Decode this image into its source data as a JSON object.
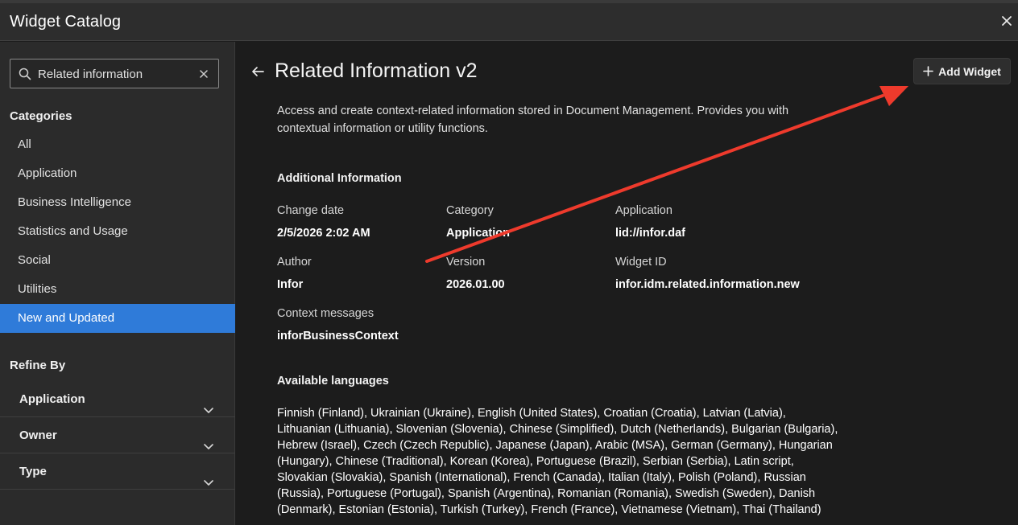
{
  "window": {
    "title": "Widget Catalog"
  },
  "search": {
    "value": "Related information"
  },
  "categories": {
    "heading": "Categories",
    "items": [
      {
        "label": "All"
      },
      {
        "label": "Application"
      },
      {
        "label": "Business Intelligence"
      },
      {
        "label": "Statistics and Usage"
      },
      {
        "label": "Social"
      },
      {
        "label": "Utilities"
      },
      {
        "label": "New and Updated",
        "active": true
      }
    ]
  },
  "refine": {
    "heading": "Refine By",
    "items": [
      {
        "label": "Application"
      },
      {
        "label": "Owner"
      },
      {
        "label": "Type"
      }
    ]
  },
  "detail": {
    "title": "Related Information v2",
    "add_button": "Add Widget",
    "description": "Access and create context-related information stored in Document Management. Provides you with contextual information or utility functions.",
    "additional_heading": "Additional Information",
    "fields": {
      "change_date": {
        "label": "Change date",
        "value": "2/5/2026 2:02 AM"
      },
      "category": {
        "label": "Category",
        "value": "Application"
      },
      "application": {
        "label": "Application",
        "value": "lid://infor.daf"
      },
      "author": {
        "label": "Author",
        "value": "Infor"
      },
      "version": {
        "label": "Version",
        "value": "2026.01.00"
      },
      "widget_id": {
        "label": "Widget ID",
        "value": "infor.idm.related.information.new"
      },
      "context_messages": {
        "label": "Context messages",
        "value": "inforBusinessContext"
      }
    },
    "languages_heading": "Available languages",
    "languages": "Finnish (Finland), Ukrainian (Ukraine), English (United States), Croatian (Croatia), Latvian (Latvia), Lithuanian (Lithuania), Slovenian (Slovenia), Chinese (Simplified), Dutch (Netherlands), Bulgarian (Bulgaria), Hebrew (Israel), Czech (Czech Republic), Japanese (Japan), Arabic (MSA), German (Germany), Hungarian (Hungary), Chinese (Traditional), Korean (Korea), Portuguese (Brazil), Serbian (Serbia), Latin script, Slovakian (Slovakia), Spanish (International), French (Canada), Italian (Italy), Polish (Poland), Russian (Russia), Portuguese (Portugal), Spanish (Argentina), Romanian (Romania), Swedish (Sweden), Danish (Denmark), Estonian (Estonia), Turkish (Turkey), French (France), Vietnamese (Vietnam), Thai (Thailand)"
  },
  "annotation": {
    "color": "#ee3a2c"
  }
}
